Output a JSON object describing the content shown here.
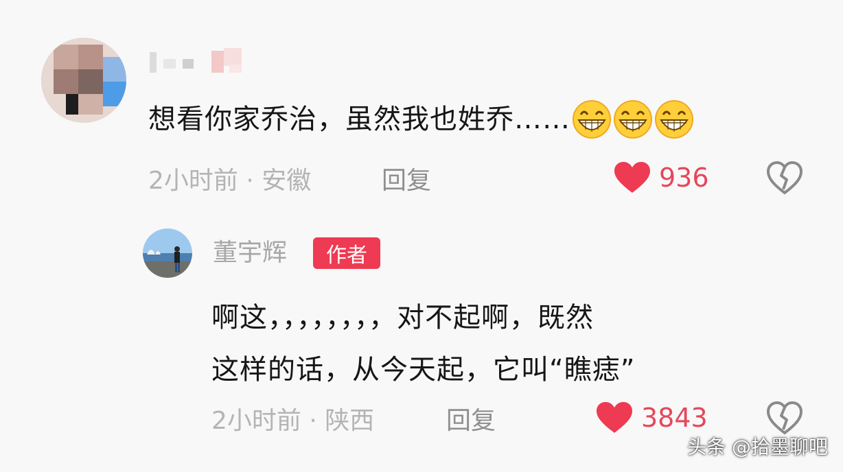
{
  "comment": {
    "text": "想看你家乔治，虽然我也姓乔……",
    "emoji_icons": [
      "grinning-face-icon",
      "grinning-face-icon",
      "grinning-face-icon"
    ],
    "time_location": "2小时前 · 安徽",
    "reply_label": "回复",
    "like_count": "936"
  },
  "reply": {
    "author_name": "董宇辉",
    "author_badge": "作者",
    "text_line1": "啊这，，，，，，，，对不起啊，既然",
    "text_line2": "这样的话，从今天起，它叫“瞧痣”",
    "time_location": "2小时前 · 陕西",
    "reply_label": "回复",
    "like_count": "3843"
  },
  "watermark": "头条 @拾墨聊吧",
  "colors": {
    "like_red": "#e6475b",
    "badge_red": "#ee3a52",
    "meta_gray": "#b4b4b4"
  }
}
